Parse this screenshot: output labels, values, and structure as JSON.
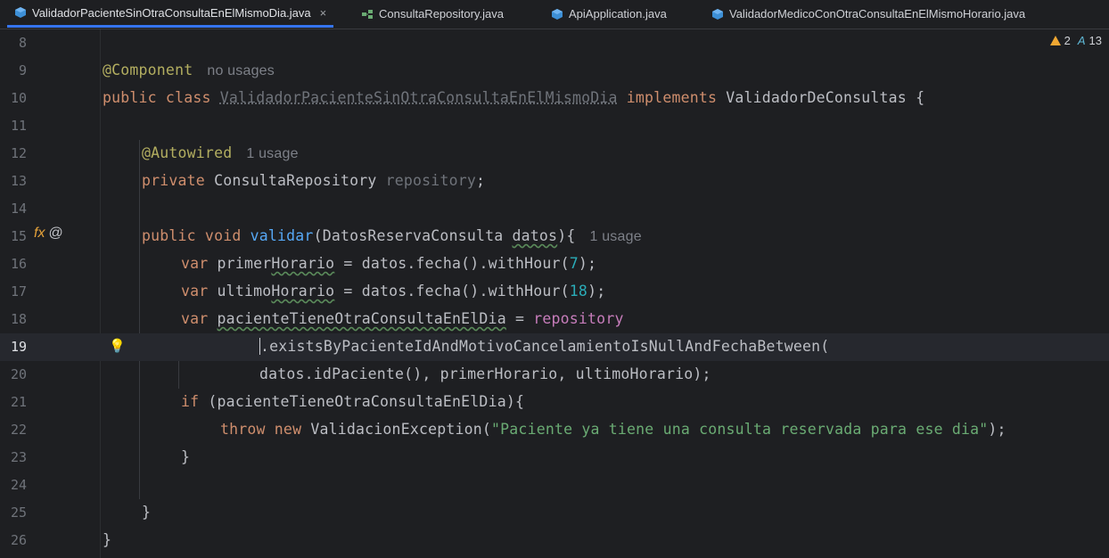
{
  "tabs": [
    {
      "label": "ValidadorPacienteSinOtraConsultaEnElMismoDia.java",
      "icon": "java-class-icon",
      "active": true
    },
    {
      "label": "ConsultaRepository.java",
      "icon": "interface-icon",
      "active": false
    },
    {
      "label": "ApiApplication.java",
      "icon": "java-class-icon",
      "active": false
    },
    {
      "label": "ValidadorMedicoConOtraConsultaEnElMismoHorario.java",
      "icon": "java-class-icon",
      "active": false
    }
  ],
  "close_glyph": "×",
  "inspections": {
    "warnings": "2",
    "typos": "13",
    "typo_glyph": "A"
  },
  "gutter": {
    "line15_icons": [
      "fx",
      "@"
    ],
    "bulb_glyph": "💡"
  },
  "hints": {
    "component": "no usages",
    "autowired": "1 usage",
    "validar": "1 usage"
  },
  "lines": {
    "n8": "8",
    "n9": "9",
    "n10": "10",
    "n11": "11",
    "n12": "12",
    "n13": "13",
    "n14": "14",
    "n15": "15",
    "n16": "16",
    "n17": "17",
    "n18": "18",
    "n19": "19",
    "n20": "20",
    "n21": "21",
    "n22": "22",
    "n23": "23",
    "n24": "24",
    "n25": "25",
    "n26": "26"
  },
  "code": {
    "l9_ann": "@Component",
    "l10_kw1": "public class",
    "l10_name": "ValidadorPacienteSinOtraConsultaEnElMismoDia",
    "l10_kw2": "implements",
    "l10_iface": "ValidadorDeConsultas {",
    "l12_ann": "@Autowired",
    "l13_kw": "private",
    "l13_type": "ConsultaRepository",
    "l13_field": "repository",
    "l13_semi": ";",
    "l15_kw": "public void",
    "l15_fn": "validar",
    "l15_params_a": "(DatosReservaConsulta ",
    "l15_param": "datos",
    "l15_params_b": "){",
    "l16_kw": "var",
    "l16_a": "primer",
    "l16_b": "Horario",
    "l16_c": " = datos.fecha().withHour(",
    "l16_num": "7",
    "l16_d": ");",
    "l17_kw": "var",
    "l17_a": "ultimo",
    "l17_b": "Horario",
    "l17_c": " = datos.fecha().withHour(",
    "l17_num": "18",
    "l17_d": ");",
    "l18_kw": "var",
    "l18_var": "pacienteTieneOtraConsultaEnElDia",
    "l18_eq": " = ",
    "l18_field": "repository",
    "l19_code": ".existsByPacienteIdAndMotivoCancelamientoIsNullAndFechaBetween(",
    "l20_code": "datos.idPaciente(), primerHorario, ultimoHorario);",
    "l21_kw": "if",
    "l21_code": " (pacienteTieneOtraConsultaEnElDia){",
    "l22_kw": "throw new",
    "l22_code": " ValidacionException(",
    "l22_str": "\"Paciente ya tiene una consulta reservada para ese dia\"",
    "l22_end": ");",
    "l23_code": "}",
    "l25_code": "}",
    "l26_code": "}"
  }
}
